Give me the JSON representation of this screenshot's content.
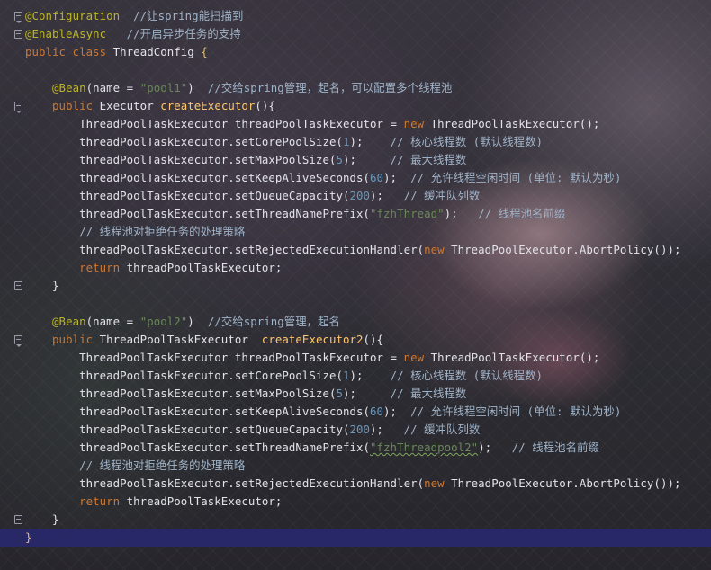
{
  "colors": {
    "annotation": "#bbb529",
    "keyword": "#cc7832",
    "string": "#6a8759",
    "number": "#6897bb",
    "comment": "#9fb3c8",
    "method_decl": "#ffc66d",
    "current_line": "#2f2f78"
  },
  "gutter_icons": [
    "fold-open-icon",
    "fold-open-icon",
    "fold-open-icon",
    "fold-close-icon",
    "fold-open-icon",
    "fold-close-icon",
    "fold-close-icon"
  ],
  "code": {
    "l1": {
      "ann": "@Configuration",
      "cmt": "  //让spring能扫描到"
    },
    "l2": {
      "ann": "@EnableAsync",
      "cmt": "   //开启异步任务的支持"
    },
    "l3": {
      "kw1": "public",
      "kw2": "class",
      "name": "ThreadConfig",
      "brace": "{"
    },
    "l5": {
      "ann": "@Bean",
      "p1": "(name = ",
      "str": "\"pool1\"",
      "p2": ")",
      "cmt": "  //交给spring管理，起名，可以配置多个线程池"
    },
    "l6": {
      "kw": "public",
      "type": "Executor",
      "method": "createExecutor",
      "rest": "(){"
    },
    "l7": {
      "a": "ThreadPoolTaskExecutor threadPoolTaskExecutor = ",
      "kw": "new",
      "b": " ThreadPoolTaskExecutor();"
    },
    "l8": {
      "a": "threadPoolTaskExecutor.setCorePoolSize(",
      "num": "1",
      "b": ");",
      "cmt": "    // 核心线程数 (默认线程数)"
    },
    "l9": {
      "a": "threadPoolTaskExecutor.setMaxPoolSize(",
      "num": "5",
      "b": ");",
      "cmt": "     // 最大线程数"
    },
    "l10": {
      "a": "threadPoolTaskExecutor.setKeepAliveSeconds(",
      "num": "60",
      "b": ");",
      "cmt": "  // 允许线程空闲时间 (单位: 默认为秒)"
    },
    "l11": {
      "a": "threadPoolTaskExecutor.setQueueCapacity(",
      "num": "200",
      "b": ");",
      "cmt": "   // 缓冲队列数"
    },
    "l12": {
      "a": "threadPoolTaskExecutor.setThreadNamePrefix(",
      "str": "\"fzhThread\"",
      "b": ");",
      "cmt": "   // 线程池名前缀"
    },
    "l13": {
      "cmt": "// 线程池对拒绝任务的处理策略"
    },
    "l14": {
      "a": "threadPoolTaskExecutor.setRejectedExecutionHandler(",
      "kw": "new",
      "b": " ThreadPoolExecutor.AbortPolicy());"
    },
    "l15": {
      "kw": "return",
      "b": " threadPoolTaskExecutor;"
    },
    "l16": {
      "brace": "}"
    },
    "l18": {
      "ann": "@Bean",
      "p1": "(name = ",
      "str": "\"pool2\"",
      "p2": ")",
      "cmt": "  //交给spring管理，起名"
    },
    "l19": {
      "kw": "public",
      "type": "ThreadPoolTaskExecutor",
      "method": "createExecutor2",
      "rest": "(){"
    },
    "l20": {
      "a": "ThreadPoolTaskExecutor threadPoolTaskExecutor = ",
      "kw": "new",
      "b": " ThreadPoolTaskExecutor();"
    },
    "l21": {
      "a": "threadPoolTaskExecutor.setCorePoolSize(",
      "num": "1",
      "b": ");",
      "cmt": "    // 核心线程数 (默认线程数)"
    },
    "l22": {
      "a": "threadPoolTaskExecutor.setMaxPoolSize(",
      "num": "5",
      "b": ");",
      "cmt": "     // 最大线程数"
    },
    "l23": {
      "a": "threadPoolTaskExecutor.setKeepAliveSeconds(",
      "num": "60",
      "b": ");",
      "cmt": "  // 允许线程空闲时间 (单位: 默认为秒)"
    },
    "l24": {
      "a": "threadPoolTaskExecutor.setQueueCapacity(",
      "num": "200",
      "b": ");",
      "cmt": "   // 缓冲队列数"
    },
    "l25": {
      "a": "threadPoolTaskExecutor.setThreadNamePrefix(",
      "str": "\"fzhThreadpool2\"",
      "b": ");",
      "cmt": "   // 线程池名前缀"
    },
    "l26": {
      "cmt": "// 线程池对拒绝任务的处理策略"
    },
    "l27": {
      "a": "threadPoolTaskExecutor.setRejectedExecutionHandler(",
      "kw": "new",
      "b": " ThreadPoolExecutor.AbortPolicy());"
    },
    "l28": {
      "kw": "return",
      "b": " threadPoolTaskExecutor;"
    },
    "l29": {
      "brace": "}"
    },
    "l30": {
      "brace": "}"
    }
  }
}
